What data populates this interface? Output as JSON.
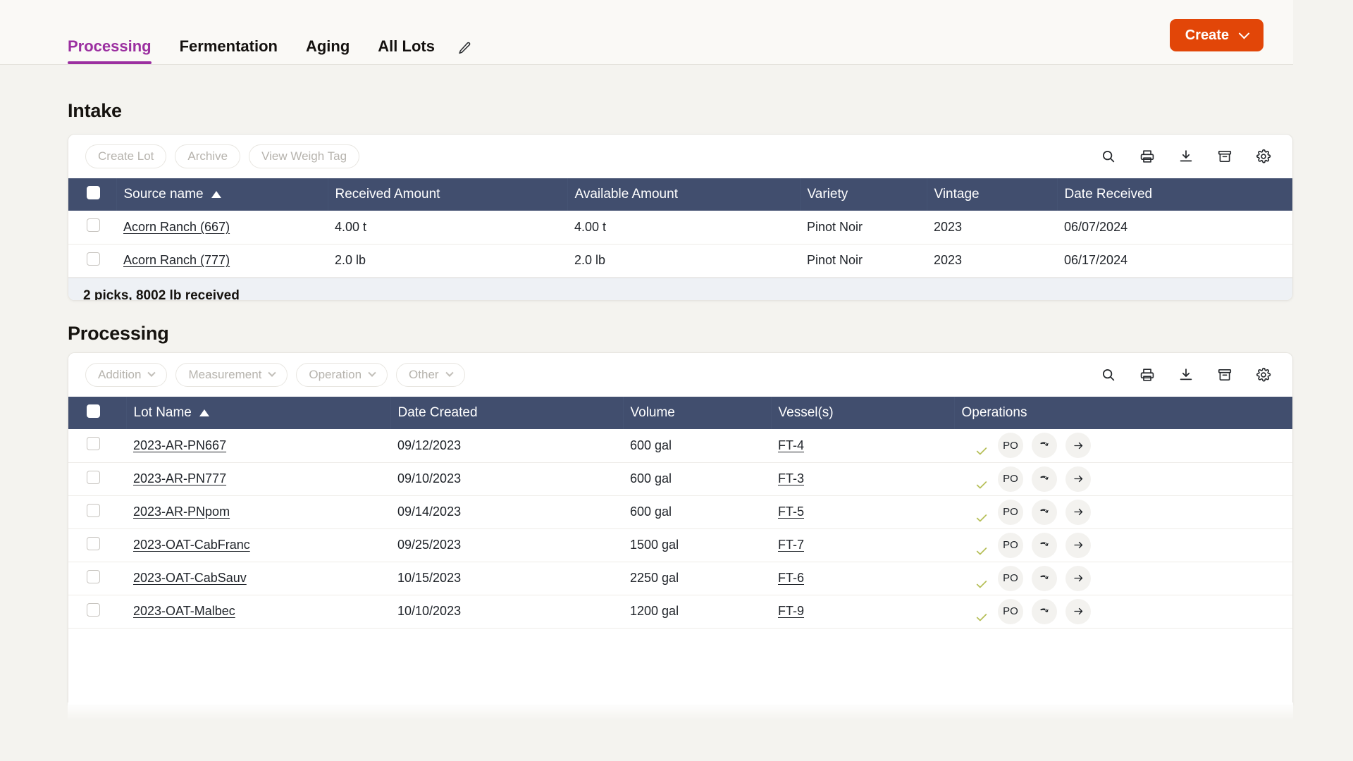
{
  "topbar": {
    "tabs": [
      {
        "label": "Processing",
        "active": true
      },
      {
        "label": "Fermentation",
        "active": false
      },
      {
        "label": "Aging",
        "active": false
      },
      {
        "label": "All Lots",
        "active": false
      }
    ],
    "edit_icon": "pencil-icon",
    "create_label": "Create",
    "accent_active_tab": "#9b2fa0",
    "create_button_color": "#e24608"
  },
  "intake": {
    "title": "Intake",
    "buttons": [
      {
        "label": "Create Lot"
      },
      {
        "label": "Archive"
      },
      {
        "label": "View Weigh Tag"
      }
    ],
    "tool_icons": [
      "search-icon",
      "print-icon",
      "download-icon",
      "archive-icon",
      "gear-icon"
    ],
    "columns": [
      "Source name",
      "Received Amount",
      "Available Amount",
      "Variety",
      "Vintage",
      "Date Received"
    ],
    "sorted_column": "Source name",
    "sort_direction": "asc",
    "rows": [
      {
        "source_name": "Acorn Ranch (667)",
        "received_amount": "4.00 t",
        "available_amount": "4.00 t",
        "variety": "Pinot Noir",
        "vintage": "2023",
        "date_received": "06/07/2024"
      },
      {
        "source_name": "Acorn Ranch (777)",
        "received_amount": "2.0 lb",
        "available_amount": "2.0 lb",
        "variety": "Pinot Noir",
        "vintage": "2023",
        "date_received": "06/17/2024"
      }
    ],
    "summary": "2 picks, 8002 lb received"
  },
  "processing": {
    "title": "Processing",
    "filters": [
      {
        "label": "Addition"
      },
      {
        "label": "Measurement"
      },
      {
        "label": "Operation"
      },
      {
        "label": "Other"
      }
    ],
    "tool_icons": [
      "search-icon",
      "print-icon",
      "download-icon",
      "archive-icon",
      "gear-icon"
    ],
    "columns": [
      "Lot Name",
      "Date Created",
      "Volume",
      "Vessel(s)",
      "Operations"
    ],
    "sorted_column": "Lot Name",
    "sort_direction": "asc",
    "rows": [
      {
        "lot_name": "2023-AR-PN667",
        "date_created": "09/12/2023",
        "volume": "600 gal",
        "vessel": "FT-4",
        "ops": {
          "check": true,
          "po": "PO",
          "pour": "pour-icon",
          "arrow": "arrow-right-icon"
        }
      },
      {
        "lot_name": "2023-AR-PN777",
        "date_created": "09/10/2023",
        "volume": "600 gal",
        "vessel": "FT-3",
        "ops": {
          "check": true,
          "po": "PO",
          "pour": "pour-icon",
          "arrow": "arrow-right-icon"
        }
      },
      {
        "lot_name": "2023-AR-PNpom",
        "date_created": "09/14/2023",
        "volume": "600 gal",
        "vessel": "FT-5",
        "ops": {
          "check": true,
          "po": "PO",
          "pour": "pour-icon",
          "arrow": "arrow-right-icon"
        }
      },
      {
        "lot_name": "2023-OAT-CabFranc",
        "date_created": "09/25/2023",
        "volume": "1500 gal",
        "vessel": "FT-7",
        "ops": {
          "check": true,
          "po": "PO",
          "pour": "pour-icon",
          "arrow": "arrow-right-icon"
        }
      },
      {
        "lot_name": "2023-OAT-CabSauv",
        "date_created": "10/15/2023",
        "volume": "2250 gal",
        "vessel": "FT-6",
        "ops": {
          "check": true,
          "po": "PO",
          "pour": "pour-icon",
          "arrow": "arrow-right-icon"
        }
      },
      {
        "lot_name": "2023-OAT-Malbec",
        "date_created": "10/10/2023",
        "volume": "1200 gal",
        "vessel": "FT-9",
        "ops": {
          "check": true,
          "po": "PO",
          "pour": "pour-icon",
          "arrow": "arrow-right-icon"
        }
      }
    ]
  }
}
